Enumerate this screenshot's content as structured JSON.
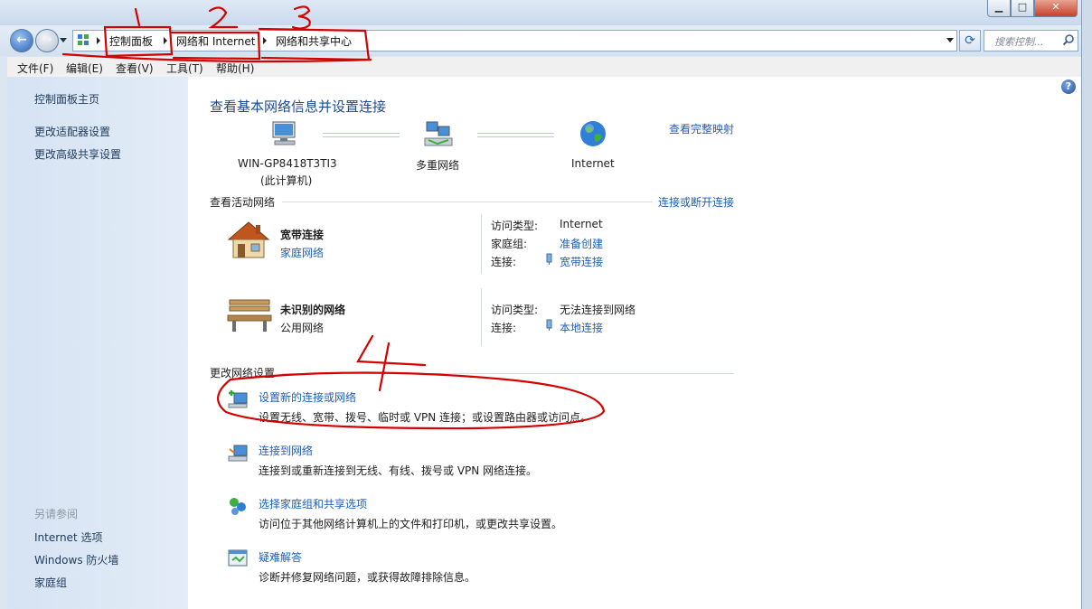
{
  "breadcrumb": {
    "items": [
      "控制面板",
      "网络和 Internet",
      "网络和共享中心"
    ]
  },
  "search": {
    "placeholder": "搜索控制..."
  },
  "menu": [
    "文件(F)",
    "编辑(E)",
    "查看(V)",
    "工具(T)",
    "帮助(H)"
  ],
  "sidebar": {
    "home": "控制面板主页",
    "links": [
      "更改适配器设置",
      "更改高级共享设置"
    ],
    "see_also_title": "另请参阅",
    "see_also": [
      "Internet 选项",
      "Windows 防火墙",
      "家庭组"
    ]
  },
  "main": {
    "title": "查看基本网络信息并设置连接",
    "full_map_link": "查看完整映射",
    "map": {
      "computer_name": "WIN-GP8418T3TI3",
      "computer_sub": "(此计算机)",
      "middle": "多重网络",
      "internet": "Internet"
    },
    "active_title": "查看活动网络",
    "connect_link": "连接或断开连接",
    "networks": [
      {
        "name": "宽带连接",
        "type": "家庭网络",
        "type_is_link": true,
        "access_label": "访问类型:",
        "access_value": "Internet",
        "homegroup_label": "家庭组:",
        "homegroup_value": "准备创建",
        "conn_label": "连接:",
        "conn_value": "宽带连接"
      },
      {
        "name": "未识别的网络",
        "type": "公用网络",
        "type_is_link": false,
        "access_label": "访问类型:",
        "access_value": "无法连接到网络",
        "conn_label": "连接:",
        "conn_value": "本地连接"
      }
    ],
    "change_title": "更改网络设置",
    "tasks": [
      {
        "title": "设置新的连接或网络",
        "desc": "设置无线、宽带、拨号、临时或 VPN 连接；或设置路由器或访问点。"
      },
      {
        "title": "连接到网络",
        "desc": "连接到或重新连接到无线、有线、拨号或 VPN 网络连接。"
      },
      {
        "title": "选择家庭组和共享选项",
        "desc": "访问位于其他网络计算机上的文件和打印机，或更改共享设置。"
      },
      {
        "title": "疑难解答",
        "desc": "诊断并修复网络问题，或获得故障排除信息。"
      }
    ]
  },
  "annotation": {
    "color": "#d40000",
    "numbers": [
      "1",
      "2",
      "3",
      "4"
    ]
  }
}
